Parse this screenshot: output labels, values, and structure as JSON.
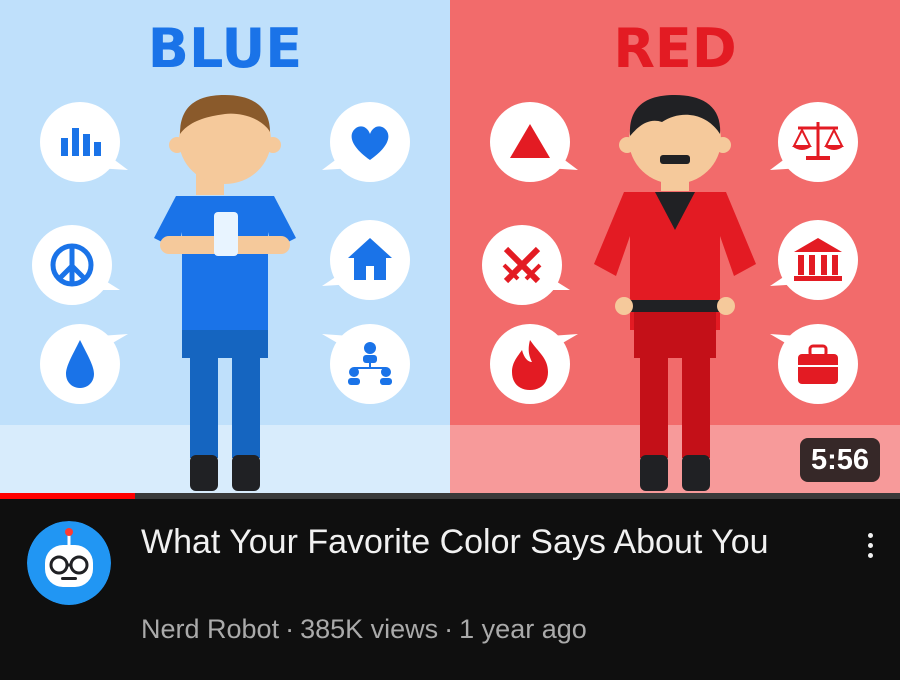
{
  "video": {
    "thumbnail": {
      "left_label": "BLUE",
      "right_label": "RED",
      "left_color": "#1a73e8",
      "right_color": "#e31b23",
      "left_icons": [
        "bar-chart-icon",
        "heart-icon",
        "peace-icon",
        "house-icon",
        "water-drop-icon",
        "team-icon"
      ],
      "right_icons": [
        "triangle-icon",
        "scales-icon",
        "crossed-swords-icon",
        "bank-icon",
        "fire-icon",
        "briefcase-icon"
      ]
    },
    "duration": "5:56",
    "watch_progress": 0.15,
    "title": "What Your Favorite Color Says About You",
    "channel": "Nerd Robot",
    "views": "385K views",
    "age": "1 year ago",
    "separator": "·"
  },
  "colors": {
    "accent": "#ff0000",
    "background": "#0f0f0f"
  }
}
